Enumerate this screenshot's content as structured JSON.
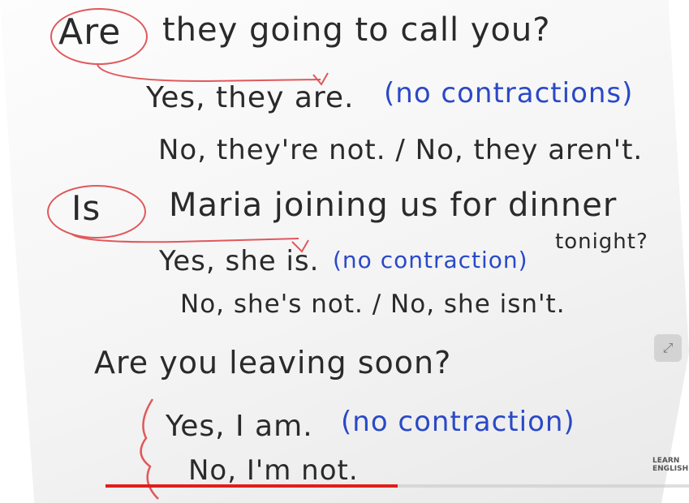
{
  "lines": {
    "q1_verb": "Are",
    "q1_rest": "they going to call you?",
    "a1_yes": "Yes, they are.",
    "a1_note": "(no contractions)",
    "a1_no": "No, they're not. / No, they aren't.",
    "q2_verb": "Is",
    "q2_rest": "Maria joining us for dinner",
    "q2_cont": "tonight?",
    "a2_yes": "Yes, she is.",
    "a2_note": "(no contraction)",
    "a2_no": "No, she's not. / No, she isn't.",
    "q3": "Are you leaving soon?",
    "a3_yes": "Yes, I am.",
    "a3_note": "(no contraction)",
    "a3_no": "No, I'm not."
  },
  "player": {
    "progress_fraction": 0.5,
    "logo_text": "LEARN ENGLISH"
  },
  "colors": {
    "ink": "#2a2a2a",
    "blue_marker": "#2a49c7",
    "red_marker": "#e0585b",
    "progress": "#e11d1d"
  },
  "icons": {
    "side_button": "expand-icon"
  }
}
